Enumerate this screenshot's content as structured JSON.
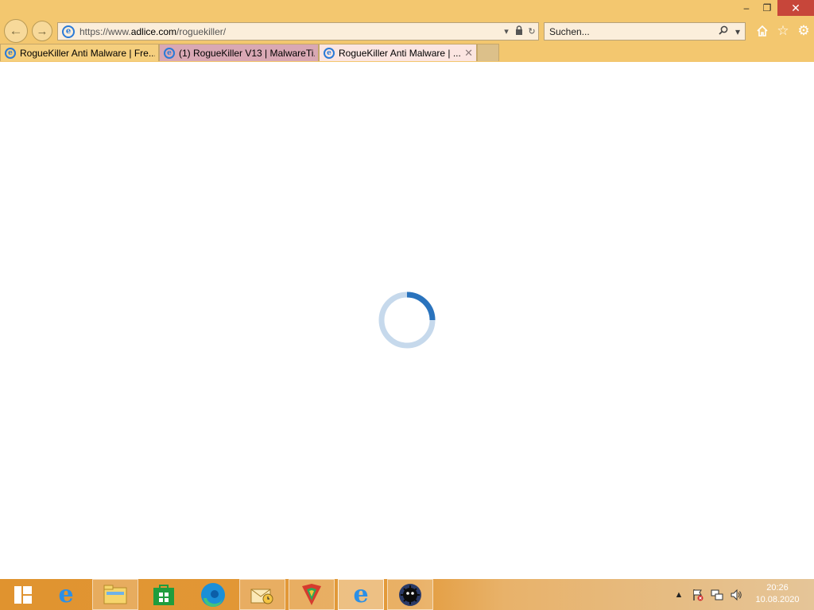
{
  "window": {
    "controls": {
      "minimize": "–",
      "restore": "❐",
      "close": "✕"
    }
  },
  "navigation": {
    "back_icon": "arrow-left-icon",
    "forward_icon": "arrow-right-icon"
  },
  "address_bar": {
    "url_prefix": "https://www.",
    "url_domain": "adlice.com",
    "url_path": "/roguekiller/",
    "icons": [
      "dropdown-icon",
      "lock-icon",
      "refresh-icon"
    ]
  },
  "search_box": {
    "placeholder": "Suchen...",
    "icons": [
      "search-icon",
      "dropdown-icon"
    ]
  },
  "toolbar_icons": [
    "home-icon",
    "favorites-icon",
    "settings-icon"
  ],
  "tabs": [
    {
      "label": "RogueKiller Anti Malware | Fre..."
    },
    {
      "label": "(1) RogueKiller V13 | MalwareTi..."
    },
    {
      "label": "RogueKiller Anti Malware | ...",
      "close": "✕"
    }
  ],
  "content": {
    "state": "loading",
    "spinner_colors": {
      "track": "#c6d9ec",
      "arc": "#2a73bd"
    }
  },
  "taskbar": {
    "items": [
      {
        "name": "start-button",
        "icon": "windows-logo-icon"
      },
      {
        "name": "internet-explorer",
        "icon": "ie-icon"
      },
      {
        "name": "file-explorer",
        "icon": "folder-icon"
      },
      {
        "name": "store",
        "icon": "store-icon"
      },
      {
        "name": "edge",
        "icon": "edge-icon"
      },
      {
        "name": "mail",
        "icon": "envelope-clock-icon"
      },
      {
        "name": "security-app",
        "icon": "shield-icon"
      },
      {
        "name": "internet-explorer-active",
        "icon": "ie-icon"
      },
      {
        "name": "roguekiller",
        "icon": "roguekiller-icon"
      }
    ],
    "tray_icons": [
      "show-hidden-icons-icon",
      "action-center-flag-icon",
      "network-icon",
      "volume-icon"
    ],
    "clock": {
      "time": "20:26",
      "date": "10.08.2020"
    }
  }
}
